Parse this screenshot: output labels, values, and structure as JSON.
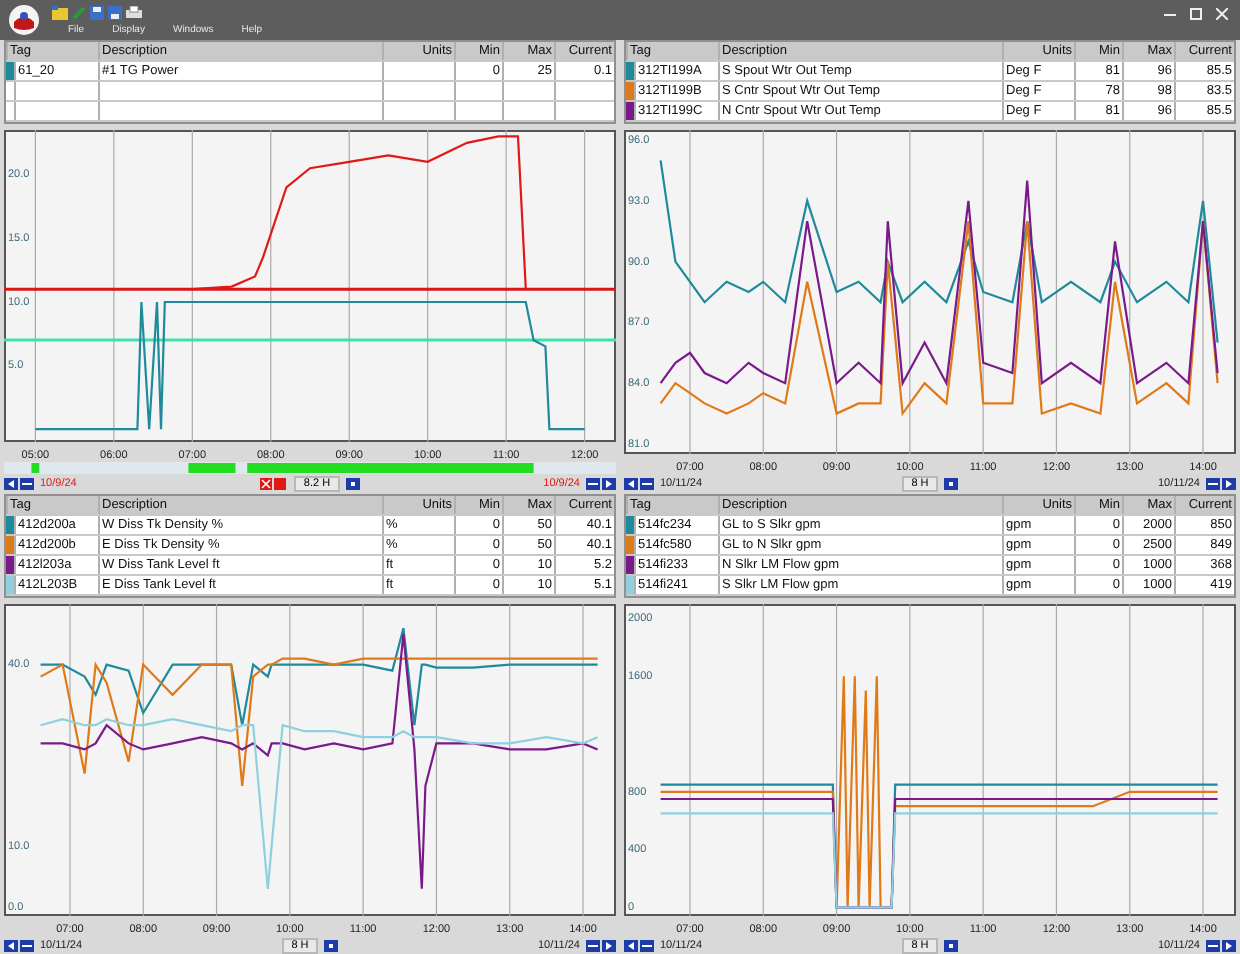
{
  "menu": [
    "File",
    "Display",
    "Windows",
    "Help"
  ],
  "panes": [
    {
      "table": {
        "columns": [
          "Tag",
          "Description",
          "Units",
          "Min",
          "Max",
          "Current"
        ],
        "rows": [
          {
            "description": "#1 TG Power",
            "units": "",
            "min": "0",
            "max": "25",
            "current": "0.1"
          }
        ]
      },
      "chart_data": {
        "type": "line",
        "grid": true,
        "xlim": [
          4.6,
          12.4
        ],
        "ylim": [
          -1,
          23.5
        ],
        "xticks": [
          {
            "value": 5,
            "label": "05:00"
          },
          {
            "value": 6,
            "label": "06:00"
          },
          {
            "value": 7,
            "label": "07:00"
          },
          {
            "value": 8,
            "label": "08:00"
          },
          {
            "value": 9,
            "label": "09:00"
          },
          {
            "value": 10,
            "label": "10:00"
          },
          {
            "value": 11,
            "label": "11:00"
          },
          {
            "value": 12,
            "label": "12:00"
          }
        ],
        "yticks": [
          {
            "value": 5,
            "label": "5.0"
          },
          {
            "value": 10,
            "label": "10.0"
          },
          {
            "value": 15,
            "label": "15.0"
          },
          {
            "value": 20,
            "label": "20.0"
          }
        ],
        "x": [
          5,
          6,
          6.3,
          6.35,
          6.45,
          6.55,
          6.6,
          6.65,
          7,
          7.5,
          7.8,
          7.9,
          8.2,
          8.5,
          9,
          9.5,
          10,
          10.5,
          10.9,
          11.15,
          11.25,
          11.35,
          11.5,
          11.55,
          12
        ],
        "series": [
          {
            "name": "61_20",
            "color": "#1f8a9c",
            "values": [
              0,
              0,
              0,
              10,
              0,
              10,
              0,
              10,
              10,
              10,
              10,
              10,
              10,
              10,
              10,
              10,
              10,
              10,
              10,
              10,
              10,
              7,
              6.5,
              0,
              0
            ]
          },
          {
            "color": "#e01818",
            "values": [
              null,
              null,
              null,
              null,
              null,
              null,
              null,
              null,
              11,
              11.2,
              12,
              13.5,
              19,
              20.5,
              21,
              21.5,
              21,
              22.5,
              23,
              23,
              11,
              null,
              null,
              null,
              null
            ]
          }
        ],
        "ref_lines": [
          {
            "axis": "y",
            "value": 11,
            "color": "#d81818"
          },
          {
            "axis": "y",
            "value": 7,
            "color": "#3fe0b0"
          }
        ]
      },
      "timeline": {
        "start": "10/9/24",
        "end": "10/9/24",
        "span": "8.2 H",
        "alarm": true,
        "coverage_bar": true
      }
    },
    {
      "table": {
        "columns": [
          "Tag",
          "Description",
          "Units",
          "Min",
          "Max",
          "Current"
        ],
        "rows": [
          {
            "description": "S Spout Wtr Out Temp",
            "units": "Deg F",
            "min": "81",
            "max": "96",
            "current": "85.5"
          },
          {
            "description": "S Cntr Spout Wtr Out Temp",
            "units": "Deg F",
            "min": "78",
            "max": "98",
            "current": "83.5"
          },
          {
            "description": "N Cntr Spout Wtr Out Temp",
            "units": "Deg F",
            "min": "81",
            "max": "96",
            "current": "85.5"
          }
        ]
      },
      "chart_data": {
        "type": "line",
        "grid": true,
        "xlim": [
          6.1,
          14.45
        ],
        "ylim": [
          80.5,
          96.5
        ],
        "xticks": [
          {
            "value": 7,
            "label": "07:00"
          },
          {
            "value": 8,
            "label": "08:00"
          },
          {
            "value": 9,
            "label": "09:00"
          },
          {
            "value": 10,
            "label": "10:00"
          },
          {
            "value": 11,
            "label": "11:00"
          },
          {
            "value": 12,
            "label": "12:00"
          },
          {
            "value": 13,
            "label": "13:00"
          },
          {
            "value": 14,
            "label": "14:00"
          }
        ],
        "yticks": [
          {
            "value": 81,
            "label": "81.0"
          },
          {
            "value": 84,
            "label": "84.0"
          },
          {
            "value": 87,
            "label": "87.0"
          },
          {
            "value": 90,
            "label": "90.0"
          },
          {
            "value": 93,
            "label": "93.0"
          },
          {
            "value": 96,
            "label": "96.0"
          }
        ],
        "x": [
          6.6,
          6.8,
          7.0,
          7.2,
          7.5,
          7.8,
          8.0,
          8.3,
          8.6,
          9.0,
          9.3,
          9.6,
          9.7,
          9.9,
          10.2,
          10.5,
          10.8,
          11.0,
          11.4,
          11.6,
          11.8,
          12.2,
          12.6,
          12.8,
          13.1,
          13.5,
          13.8,
          14.0,
          14.2
        ],
        "series": [
          {
            "name": "312TI199A",
            "color": "#1f8a9c",
            "values": [
              95,
              90,
              89,
              88,
              89,
              88.5,
              89,
              88,
              93,
              88.5,
              89,
              88,
              90,
              88,
              89,
              88,
              91,
              88.5,
              88,
              92,
              88,
              89,
              88,
              90,
              88,
              89,
              88,
              93,
              86
            ]
          },
          {
            "name": "312TI199B",
            "color": "#e07a18",
            "values": [
              83,
              84,
              83.5,
              83,
              82.5,
              83,
              83.5,
              83,
              89,
              82.5,
              83,
              83,
              90,
              82.5,
              84,
              83,
              92,
              83,
              83,
              92,
              82.5,
              83,
              82.5,
              89,
              83,
              84,
              83,
              92,
              84
            ]
          },
          {
            "name": "312TI199C",
            "color": "#7a1a8a",
            "values": [
              84,
              85,
              85.5,
              84.5,
              84,
              85,
              84.5,
              84,
              92,
              84,
              85,
              84,
              92,
              84,
              86,
              84,
              93,
              85,
              84.5,
              94,
              84,
              85,
              84,
              91,
              84,
              85,
              84,
              92,
              84.5
            ]
          }
        ]
      },
      "timeline": {
        "start": "10/11/24",
        "end": "10/11/24",
        "span": "8 H",
        "alarm": false,
        "coverage_bar": false
      }
    },
    {
      "table": {
        "columns": [
          "Tag",
          "Description",
          "Units",
          "Min",
          "Max",
          "Current"
        ],
        "rows": [
          {
            "description": "W Diss Tk Density %",
            "units": "%",
            "min": "0",
            "max": "50",
            "current": "40.1"
          },
          {
            "description": "E Diss Tk Density %",
            "units": "%",
            "min": "0",
            "max": "50",
            "current": "40.1"
          },
          {
            "description": "W Diss Tank Level ft",
            "units": "ft",
            "min": "0",
            "max": "10",
            "current": "5.2"
          },
          {
            "description": "E Diss Tank Level ft",
            "units": "ft",
            "min": "0",
            "max": "10",
            "current": "5.1"
          }
        ]
      },
      "chart_data": {
        "type": "line",
        "grid": true,
        "xlim": [
          6.1,
          14.45
        ],
        "ylim": [
          -1.5,
          50
        ],
        "xticks": [
          {
            "value": 7,
            "label": "07:00"
          },
          {
            "value": 8,
            "label": "08:00"
          },
          {
            "value": 9,
            "label": "09:00"
          },
          {
            "value": 10,
            "label": "10:00"
          },
          {
            "value": 11,
            "label": "11:00"
          },
          {
            "value": 12,
            "label": "12:00"
          },
          {
            "value": 13,
            "label": "13:00"
          },
          {
            "value": 14,
            "label": "14:00"
          }
        ],
        "yticks": [
          {
            "value": 0,
            "label": "0.0"
          },
          {
            "value": 10,
            "label": "10.0"
          },
          {
            "value": 40,
            "label": "40.0"
          }
        ],
        "x": [
          6.6,
          6.9,
          7.2,
          7.35,
          7.5,
          7.8,
          8.0,
          8.4,
          8.8,
          9.2,
          9.35,
          9.5,
          9.7,
          9.75,
          9.9,
          10.2,
          10.6,
          11.0,
          11.4,
          11.55,
          11.7,
          11.8,
          11.85,
          12.0,
          12.5,
          13.0,
          13.5,
          14.0,
          14.2
        ],
        "series": [
          {
            "name": "412d200a",
            "color": "#1f8a9c",
            "values": [
              40,
              40,
              38,
              35,
              40,
              39,
              32,
              40,
              40,
              40,
              30,
              40,
              38,
              40,
              40,
              40,
              40,
              40,
              39,
              46,
              30,
              40,
              40,
              39.5,
              39.5,
              40,
              40,
              40,
              40
            ]
          },
          {
            "name": "412d200b",
            "color": "#e07a18",
            "values": [
              38,
              40,
              22,
              40,
              37,
              24,
              40,
              35,
              40,
              40,
              20,
              38,
              40,
              40,
              41,
              41,
              40,
              41,
              41,
              41,
              41,
              41,
              41,
              41,
              41,
              41,
              41,
              41,
              41
            ]
          },
          {
            "name": "412l203a",
            "color": "#7a1a8a",
            "values": [
              27,
              27,
              26,
              27,
              30,
              27,
              26,
              27,
              28,
              27,
              26,
              27,
              25,
              27,
              27,
              26,
              27,
              26,
              27,
              45,
              26,
              3,
              20,
              27,
              27,
              26,
              26,
              27,
              26
            ]
          },
          {
            "name": "412L203B",
            "color": "#8fd0e0",
            "values": [
              30,
              31,
              30,
              30,
              31,
              30,
              30,
              31,
              30,
              29,
              30,
              30,
              3,
              10,
              30,
              29,
              29,
              28,
              28,
              29,
              28,
              28,
              28,
              28,
              27,
              27,
              28,
              27,
              28
            ]
          }
        ]
      },
      "timeline": {
        "start": "10/11/24",
        "end": "10/11/24",
        "span": "8 H",
        "alarm": false,
        "coverage_bar": false
      }
    },
    {
      "table": {
        "columns": [
          "Tag",
          "Description",
          "Units",
          "Min",
          "Max",
          "Current"
        ],
        "rows": [
          {
            "description": "GL to S Slkr gpm",
            "units": "gpm",
            "min": "0",
            "max": "2000",
            "current": "850"
          },
          {
            "description": "GL to N Slkr gpm",
            "units": "gpm",
            "min": "0",
            "max": "2500",
            "current": "849"
          },
          {
            "description": "N Slkr LM Flow gpm",
            "units": "gpm",
            "min": "0",
            "max": "1000",
            "current": "368"
          },
          {
            "description": "S Slkr LM Flow gpm",
            "units": "gpm",
            "min": "0",
            "max": "1000",
            "current": "419"
          }
        ]
      },
      "chart_data": {
        "type": "line",
        "grid": true,
        "xlim": [
          6.1,
          14.45
        ],
        "ylim": [
          -60,
          2100
        ],
        "xticks": [
          {
            "value": 7,
            "label": "07:00"
          },
          {
            "value": 8,
            "label": "08:00"
          },
          {
            "value": 9,
            "label": "09:00"
          },
          {
            "value": 10,
            "label": "10:00"
          },
          {
            "value": 11,
            "label": "11:00"
          },
          {
            "value": 12,
            "label": "12:00"
          },
          {
            "value": 13,
            "label": "13:00"
          },
          {
            "value": 14,
            "label": "14:00"
          }
        ],
        "yticks": [
          {
            "value": 0,
            "label": "0"
          },
          {
            "value": 400,
            "label": "400"
          },
          {
            "value": 800,
            "label": "800"
          },
          {
            "value": 1600,
            "label": "1600"
          },
          {
            "value": 2000,
            "label": "2000"
          }
        ],
        "x": [
          6.6,
          7.5,
          8.5,
          8.95,
          9.0,
          9.1,
          9.15,
          9.25,
          9.3,
          9.4,
          9.45,
          9.55,
          9.6,
          9.75,
          9.8,
          10.5,
          11.5,
          12.5,
          13.0,
          13.5,
          14.0,
          14.2
        ],
        "series": [
          {
            "name": "514fc234",
            "color": "#1f8a9c",
            "values": [
              850,
              850,
              850,
              850,
              0,
              0,
              0,
              0,
              0,
              0,
              0,
              0,
              0,
              0,
              850,
              850,
              850,
              850,
              850,
              850,
              850,
              850
            ]
          },
          {
            "name": "514fc580",
            "color": "#e07a18",
            "values": [
              800,
              800,
              800,
              800,
              0,
              1600,
              0,
              1600,
              0,
              1500,
              0,
              1600,
              0,
              0,
              700,
              700,
              700,
              700,
              800,
              800,
              800,
              800
            ]
          },
          {
            "name": "514fi233",
            "color": "#7a1a8a",
            "values": [
              750,
              750,
              750,
              750,
              0,
              0,
              0,
              0,
              0,
              0,
              0,
              0,
              0,
              0,
              750,
              750,
              750,
              750,
              750,
              750,
              750,
              750
            ]
          },
          {
            "name": "514fi241",
            "color": "#8fd0e0",
            "values": [
              650,
              650,
              650,
              650,
              0,
              0,
              0,
              0,
              0,
              0,
              0,
              0,
              0,
              0,
              650,
              650,
              650,
              650,
              650,
              650,
              650,
              650
            ]
          }
        ]
      },
      "timeline": {
        "start": "10/11/24",
        "end": "10/11/24",
        "span": "8 H",
        "alarm": false,
        "coverage_bar": false
      }
    }
  ]
}
